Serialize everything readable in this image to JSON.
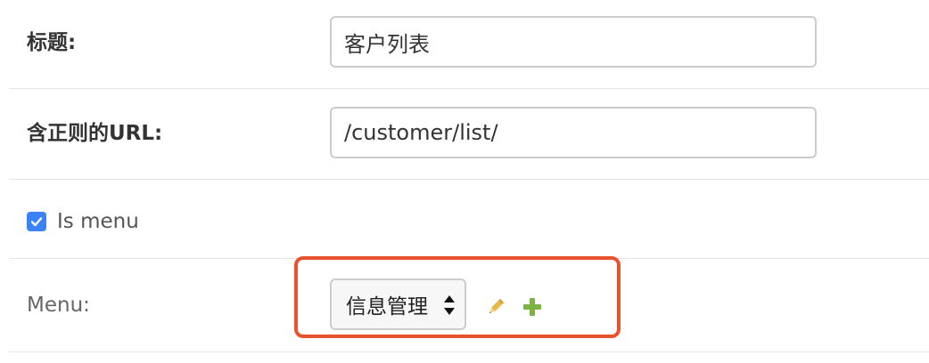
{
  "form": {
    "title": {
      "label": "标题:",
      "value": "客户列表"
    },
    "url": {
      "label": "含正则的URL:",
      "value": "/customer/list/"
    },
    "is_menu": {
      "label": "Is menu",
      "checked": true
    },
    "menu": {
      "label": "Menu:",
      "selected": "信息管理"
    }
  },
  "icons": {
    "edit": "pencil-icon",
    "add": "plus-icon"
  },
  "colors": {
    "checkbox": "#3b82f6",
    "highlight": "#e8532e",
    "pencil": "#e8b84a",
    "plus": "#7cb342"
  }
}
